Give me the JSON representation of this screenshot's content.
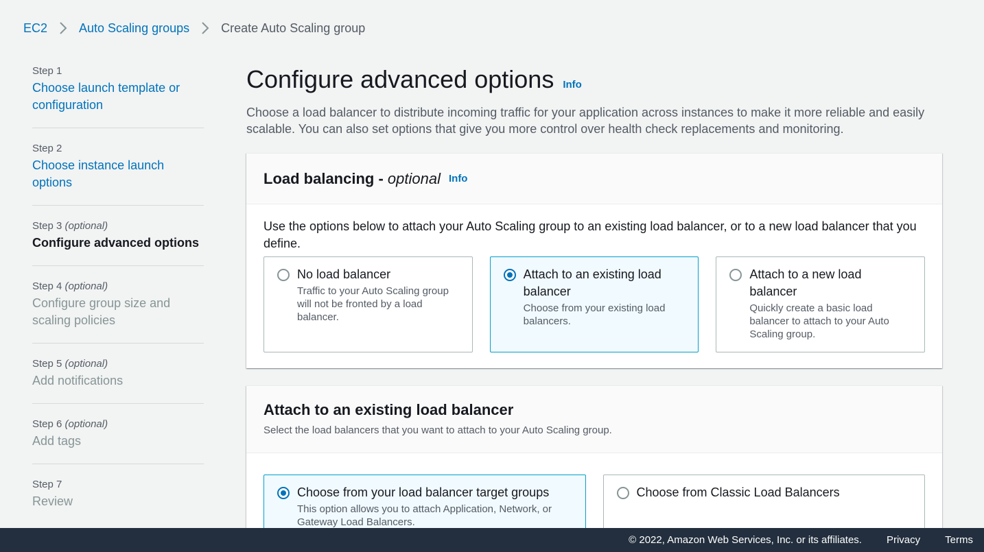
{
  "breadcrumb": {
    "items": [
      "EC2",
      "Auto Scaling groups"
    ],
    "current": "Create Auto Scaling group"
  },
  "steps": [
    {
      "num": "Step 1",
      "optional": "",
      "title": "Choose launch template or configuration"
    },
    {
      "num": "Step 2",
      "optional": "",
      "title": "Choose instance launch options"
    },
    {
      "num": "Step 3",
      "optional": "(optional)",
      "title": "Configure advanced options"
    },
    {
      "num": "Step 4",
      "optional": "(optional)",
      "title": "Configure group size and scaling policies"
    },
    {
      "num": "Step 5",
      "optional": "(optional)",
      "title": "Add notifications"
    },
    {
      "num": "Step 6",
      "optional": "(optional)",
      "title": "Add tags"
    },
    {
      "num": "Step 7",
      "optional": "",
      "title": "Review"
    }
  ],
  "page": {
    "title": "Configure advanced options",
    "info": "Info",
    "description": "Choose a load balancer to distribute incoming traffic for your application across instances to make it more reliable and easily scalable. You can also set options that give you more control over health check replacements and monitoring."
  },
  "load_balancing": {
    "title": "Load balancing - ",
    "title_optional": "optional",
    "info": "Info",
    "lead": "Use the options below to attach your Auto Scaling group to an existing load balancer, or to a new load balancer that you define.",
    "options": [
      {
        "title": "No load balancer",
        "desc": "Traffic to your Auto Scaling group will not be fronted by a load balancer.",
        "selected": false
      },
      {
        "title": "Attach to an existing load balancer",
        "desc": "Choose from your existing load balancers.",
        "selected": true
      },
      {
        "title": "Attach to a new load balancer",
        "desc": "Quickly create a basic load balancer to attach to your Auto Scaling group.",
        "selected": false
      }
    ]
  },
  "attach": {
    "title": "Attach to an existing load balancer",
    "subtitle": "Select the load balancers that you want to attach to your Auto Scaling group.",
    "options": [
      {
        "title": "Choose from your load balancer target groups",
        "desc": "This option allows you to attach Application, Network, or Gateway Load Balancers.",
        "selected": true
      },
      {
        "title": "Choose from Classic Load Balancers",
        "desc": "",
        "selected": false
      }
    ]
  },
  "footer": {
    "copyright": "© 2022, Amazon Web Services, Inc. or its affiliates.",
    "privacy": "Privacy",
    "terms": "Terms"
  },
  "colors": {
    "link": "#0073bb",
    "selected_border": "#00a1c9",
    "selected_bg": "#f1faff",
    "footer_bg": "#232f3e"
  }
}
